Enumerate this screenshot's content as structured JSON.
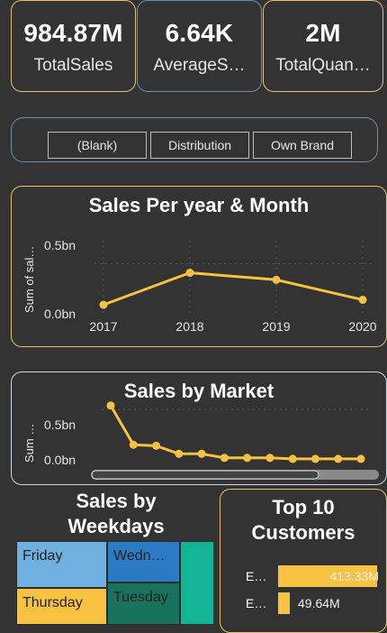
{
  "kpis": [
    {
      "value": "984.87M",
      "label": "TotalSales"
    },
    {
      "value": "6.64K",
      "label": "AverageS…"
    },
    {
      "value": "2M",
      "label": "TotalQuan…"
    }
  ],
  "slicer": {
    "options": [
      "(Blank)",
      "Distribution",
      "Own Brand"
    ]
  },
  "sales_per_year": {
    "title": "Sales Per year & Month",
    "ylabel": "Sum of sal…",
    "yticks": [
      "0.5bn",
      "0.0bn"
    ],
    "xticks": [
      "2017",
      "2018",
      "2019",
      "2020"
    ]
  },
  "sales_by_market": {
    "title": "Sales by Market",
    "ylabel": "Sum …",
    "yticks": [
      "0.5bn",
      "0.0bn"
    ]
  },
  "weekdays": {
    "title_line1": "Sales by",
    "title_line2": "Weekdays",
    "cells": [
      "Friday",
      "Wedn…",
      "Thursday",
      "Tuesday"
    ]
  },
  "top_customers": {
    "title_line1": "Top 10",
    "title_line2": "Customers",
    "rows": [
      {
        "label": "E…",
        "value": "413.33M"
      },
      {
        "label": "E…",
        "value": "49.64M"
      }
    ]
  },
  "colors": {
    "accent": "#f7c242",
    "card_border": "#e8c06a",
    "slicer_border": "#6f8fae",
    "background": "#333333"
  },
  "chart_data": [
    {
      "type": "line",
      "title": "Sales Per year & Month",
      "xlabel": "",
      "ylabel": "Sum of sal…",
      "x": [
        2017,
        2018,
        2019,
        2020
      ],
      "values": [
        0.09,
        0.41,
        0.34,
        0.14
      ],
      "ylim": [
        0,
        0.55
      ],
      "grid": true
    },
    {
      "type": "line",
      "title": "Sales by Market",
      "ylabel": "Sum …",
      "values": [
        0.54,
        0.15,
        0.14,
        0.06,
        0.06,
        0.02,
        0.02,
        0.02,
        0.01,
        0.01,
        0.01,
        0.01
      ],
      "ylim": [
        0,
        0.6
      ],
      "grid": true
    },
    {
      "type": "bar",
      "title": "Top 10 Customers",
      "categories": [
        "E…",
        "E…"
      ],
      "values": [
        413.33,
        49.64
      ],
      "unit": "M"
    }
  ]
}
